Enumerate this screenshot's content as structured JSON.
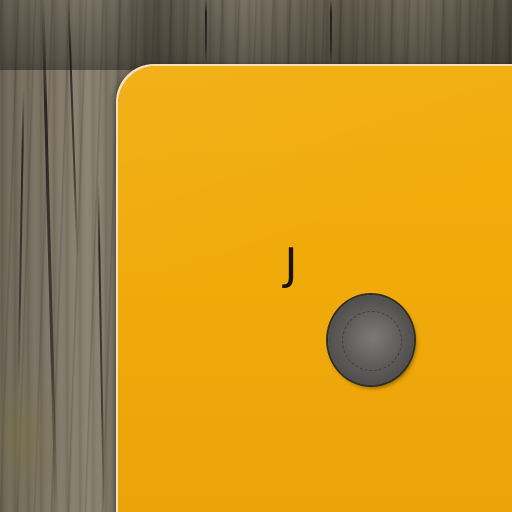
{
  "scene": {
    "description_free": true,
    "plate": {
      "letter": "J",
      "color": "#f0a90a"
    },
    "background": {
      "material": "weathered wood",
      "color": "#7a7162"
    },
    "icons": {
      "nail": "nail-head-icon"
    }
  }
}
